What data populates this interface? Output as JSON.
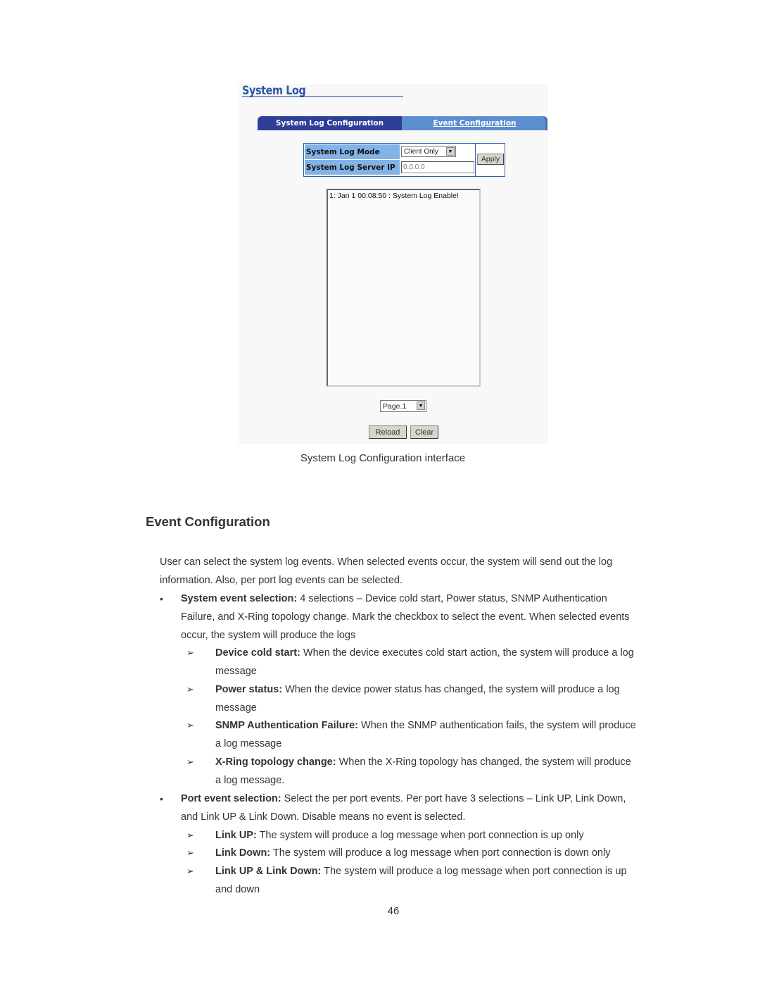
{
  "screenshot": {
    "title": "System Log",
    "tabs": [
      {
        "label": "System Log Configuration",
        "active": true
      },
      {
        "label": "Event Configuration",
        "active": false
      }
    ],
    "form": {
      "mode_label": "System Log Mode",
      "mode_value": "Client Only",
      "server_ip_label": "System Log Server IP",
      "server_ip_value": "0.0.0.0",
      "apply_label": "Apply"
    },
    "log_entries": [
      "1: Jan 1  00:08:50 : System Log Enable!"
    ],
    "page_select_value": "Page.1",
    "reload_label": "Reload",
    "clear_label": "Clear",
    "colors": {
      "tab_active": "#2f3e97",
      "tab_inactive": "#5b8fd0",
      "label_bg": "#82b2e6",
      "title": "#2b56a8"
    }
  },
  "caption": "System Log Configuration interface",
  "section_title": "Event Configuration",
  "intro": "User can select the system log events. When selected events occur, the system will send out the log information. Also, per port log events can be selected.",
  "bullets": [
    {
      "bold": "System event selection:",
      "text": " 4 selections – Device cold start, Power status, SNMP Authentication Failure, and X-Ring topology change. Mark the checkbox to select the event. When selected events occur, the system will produce the logs",
      "sub": [
        {
          "bold": "Device cold start:",
          "text": " When the device executes cold start action, the system will produce a log message"
        },
        {
          "bold": "Power status:",
          "text": " When the device power status has changed, the system will produce a log message"
        },
        {
          "bold": "SNMP Authentication Failure:",
          "text": " When the SNMP authentication fails, the system will produce a log message"
        },
        {
          "bold": "X-Ring topology change:",
          "text": " When the X-Ring topology has changed, the system will produce a log message."
        }
      ]
    },
    {
      "bold": "Port event selection:",
      "text": " Select the per port events. Per port have 3 selections – Link UP, Link Down, and Link UP & Link Down. Disable means no event is selected.",
      "sub": [
        {
          "bold": "Link UP:",
          "text": " The system will produce a log message when port connection is up only"
        },
        {
          "bold": "Link Down:",
          "text": " The system will produce a log message when port connection is down only"
        },
        {
          "bold": "Link UP & Link Down:",
          "text": " The system will produce a log message when port connection is up and down"
        }
      ]
    }
  ],
  "bullet_glyph": "•",
  "sub_bullet_glyph": "➢",
  "page_number": "46"
}
